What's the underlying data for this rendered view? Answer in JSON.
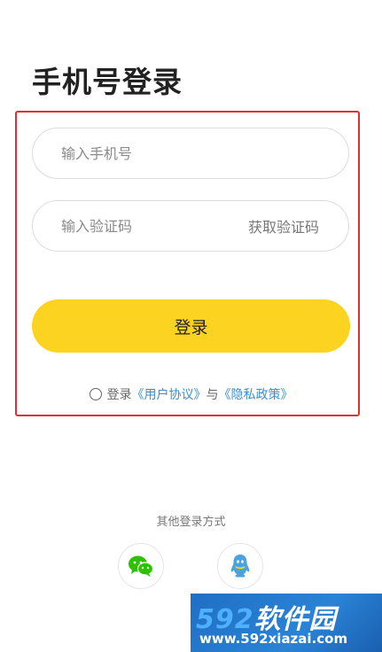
{
  "page": {
    "title": "手机号登录"
  },
  "form": {
    "phone_placeholder": "输入手机号",
    "code_placeholder": "输入验证码",
    "get_code_label": "获取验证码",
    "login_label": "登录"
  },
  "agreement": {
    "checked": false,
    "prefix": "登录",
    "user_agreement": "《用户协议》",
    "conjunction": "与",
    "privacy_policy": "《隐私政策》",
    "link_color": "#3b8fd0"
  },
  "other_login": {
    "label": "其他登录方式",
    "options": [
      {
        "name": "wechat",
        "icon": "wechat-icon",
        "color": "#2dc100"
      },
      {
        "name": "qq",
        "icon": "qq-icon",
        "color": "#4aa3e0"
      }
    ]
  },
  "watermark": {
    "logo_digits": "592",
    "logo_text": "软件园",
    "url": "www.592xiazai.com"
  },
  "colors": {
    "accent": "#fdd321",
    "highlight_frame": "#e03030"
  }
}
